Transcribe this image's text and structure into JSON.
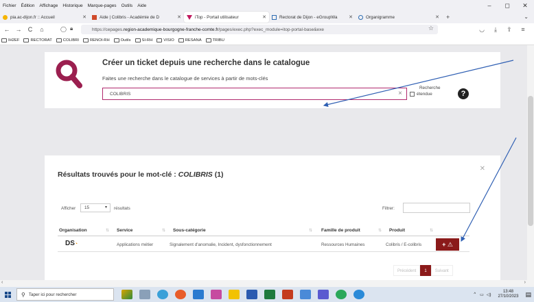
{
  "menubar": {
    "items": [
      "Fichier",
      "Édition",
      "Affichage",
      "Historique",
      "Marque-pages",
      "Outils",
      "Aide"
    ]
  },
  "window_controls": {
    "minimize": "–",
    "maximize": "◻",
    "close": "✕"
  },
  "tabs": [
    {
      "label": "pia.ac-dijon.fr :: Accueil",
      "icon": "pia-favicon",
      "color": "#f6b400"
    },
    {
      "label": "Aide | Colibris - Académie de D",
      "icon": "colibris-favicon",
      "color": "#d04a2a"
    },
    {
      "label": "iTop - Portail utilisateur",
      "icon": "itop-favicon",
      "color": "#c0185e",
      "active": true
    },
    {
      "label": "Rectorat de Dijon - eGroupWa",
      "icon": "egroupware-favicon",
      "color": "#2a6ab0"
    },
    {
      "label": "Organigramme",
      "icon": "organigramme-favicon",
      "color": "#2a6ab0"
    }
  ],
  "nav": {
    "back": "←",
    "forward": "→",
    "reload": "C",
    "home": "⌂",
    "url_prefix": "https://cepages.",
    "url_domain": "region-academique-bourgogne-franche-comte.fr",
    "url_suffix": "/pages/exec.php?exec_module=itop-portal-base&exe"
  },
  "bookmarks": [
    "IH2EF",
    "RECTORAT",
    "COLIBRI",
    "RENOI-RH",
    "Outils",
    "SI-RH",
    "VISIO",
    "RESANA",
    "TRIBU"
  ],
  "catalog": {
    "title": "Créer un ticket depuis une recherche dans le catalogue",
    "subtitle": "Faites une recherche dans le catalogue de services à partir de mots-clés",
    "search_value": "COLIBRIS",
    "extended_label_1": "Recherche",
    "extended_label_2": "étendue",
    "help": "?"
  },
  "results": {
    "title_prefix": "Résultats trouvés pour le mot-clé : ",
    "keyword": "COLIBRIS",
    "count": " (1)",
    "show_label": "Afficher",
    "page_size": "15",
    "results_suffix": "résultats",
    "filter_label": "Filtrer:",
    "columns": [
      "Organisation",
      "Service",
      "Sous-catégorie",
      "Famille de produit",
      "Produit"
    ],
    "row": {
      "organisation": "DS",
      "service": "Applications métier",
      "subcategory": "Signalement d'anomalie, Incident, dysfonctionnement",
      "family": "Ressources Humaines",
      "product": "Colibris / E-colibris",
      "action": "+ ⚠"
    },
    "pager": {
      "prev": "Précédent",
      "current": "1",
      "next": "Suivant"
    }
  },
  "taskbar": {
    "search_placeholder": "Taper ici pour rechercher",
    "time": "13:48",
    "date": "27/10/2023"
  },
  "colors": {
    "accent": "#b0276c",
    "button": "#8b1a1a",
    "arrow": "#2f5fb3"
  }
}
